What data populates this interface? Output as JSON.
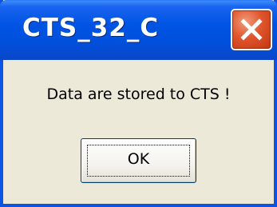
{
  "dialog": {
    "title": "CTS_32_C",
    "message": "Data are stored to CTS !",
    "ok_label": "OK",
    "close_icon": "close-icon"
  },
  "colors": {
    "titlebar": "#0054e3",
    "close_button": "#e0552d",
    "dialog_background": "#ece9d8"
  }
}
